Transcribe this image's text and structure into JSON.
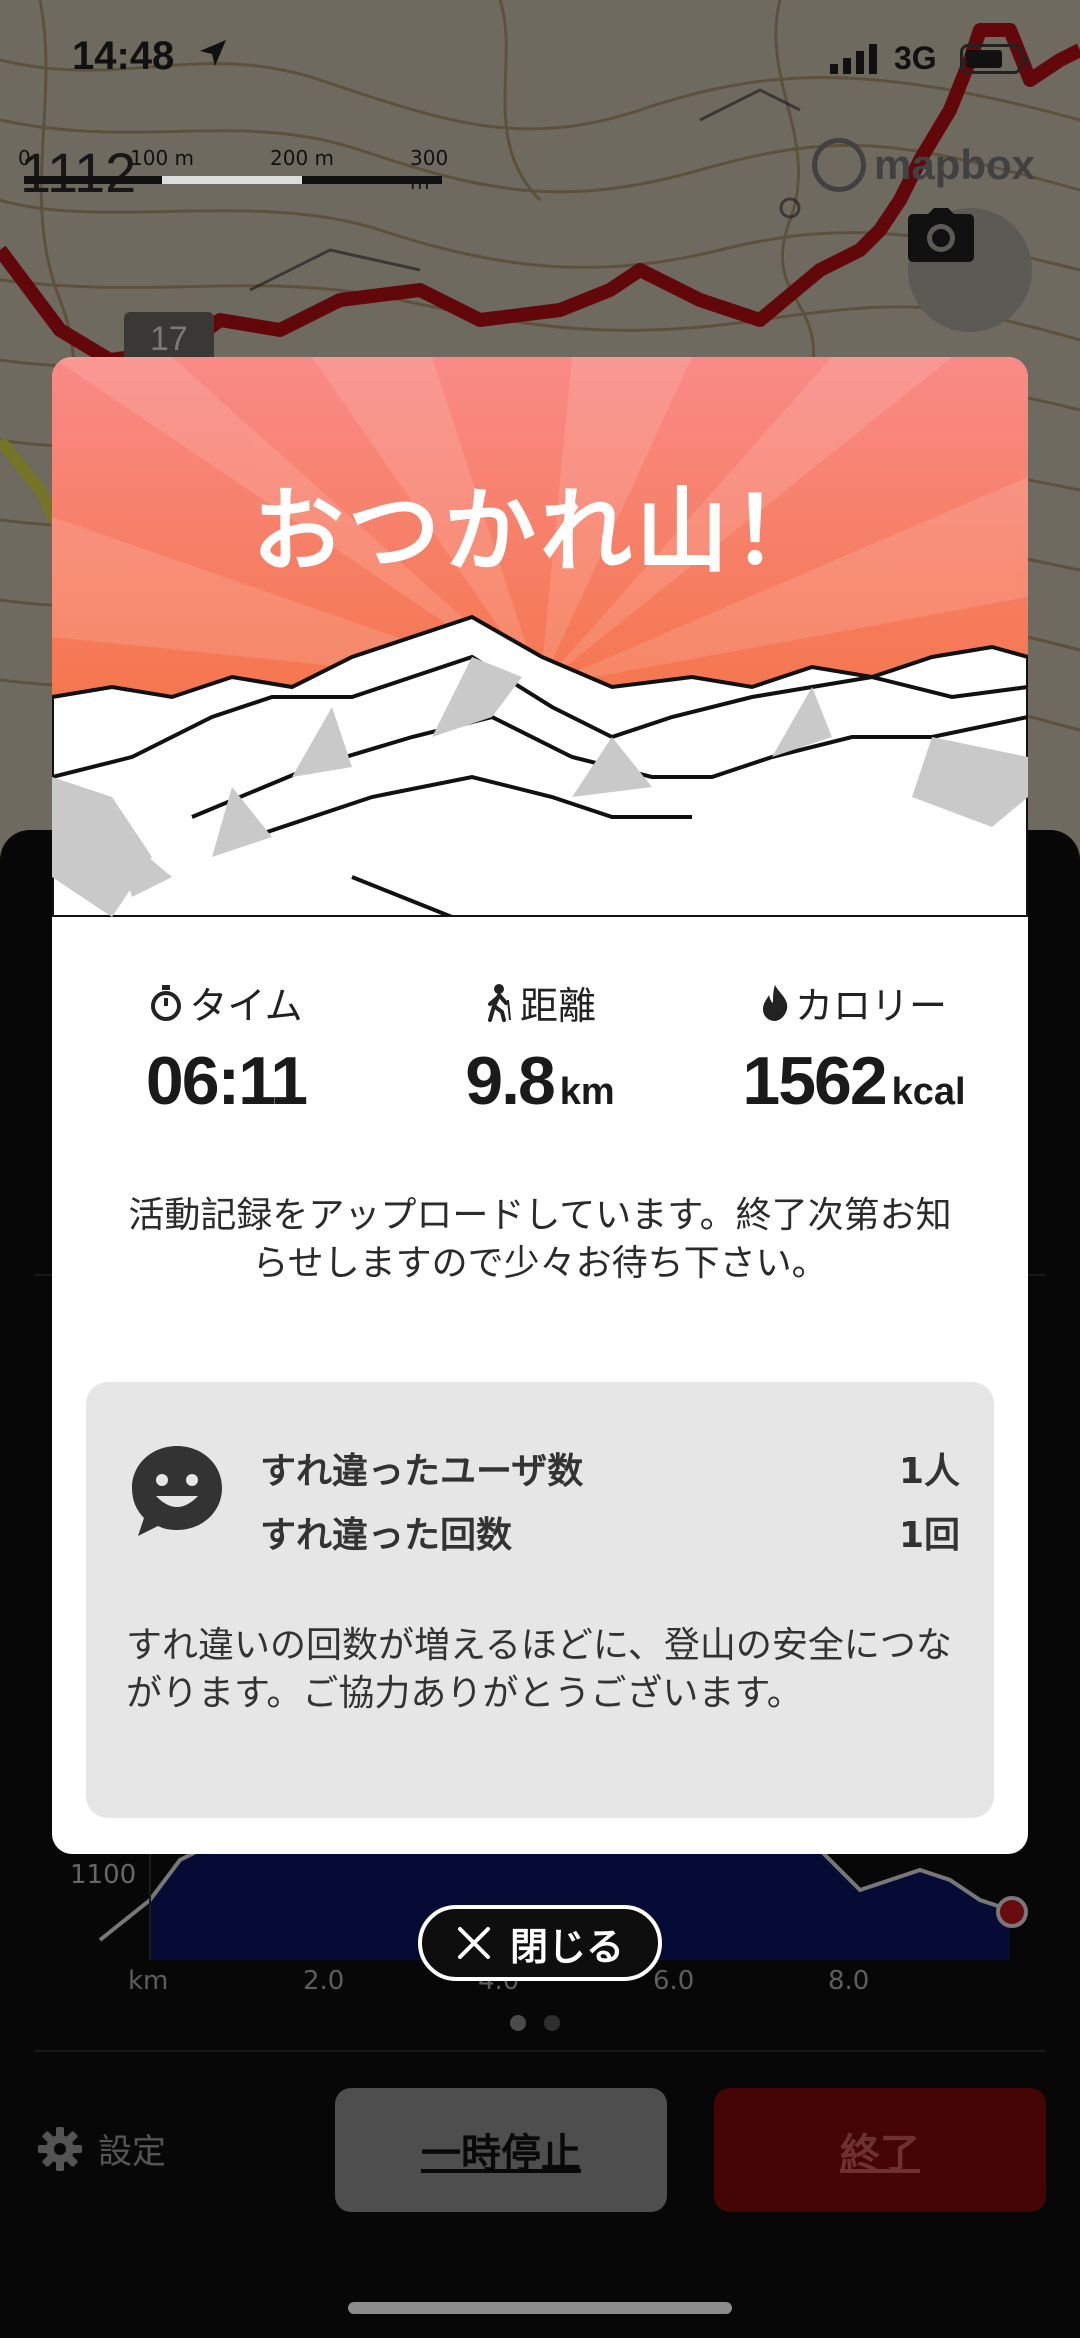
{
  "status_bar": {
    "time": "14:48",
    "network": "3G",
    "icons": [
      "location-arrow-icon",
      "signal-icon",
      "battery-icon"
    ]
  },
  "map": {
    "scale_labels": [
      "0",
      "100 m",
      "200 m",
      "300 m"
    ],
    "map_number": "1112",
    "grid_number": "17",
    "attribution": "mapbox",
    "camera_icon": "camera-icon",
    "route_color": "#b30f14"
  },
  "modal": {
    "title": "おつかれ山！",
    "stats": {
      "time": {
        "label": "タイム",
        "value": "06:11",
        "icon": "stopwatch-icon"
      },
      "distance": {
        "label": "距離",
        "value": "9.8",
        "unit": "km",
        "icon": "hiker-icon"
      },
      "calories": {
        "label": "カロリー",
        "value": "1562",
        "unit": "kcal",
        "icon": "flame-icon"
      }
    },
    "upload_message": "活動記録をアップロードしています。終了次第お知らせしますので少々お待ち下さい。",
    "passing": {
      "users_label": "すれ違ったユーザ数",
      "users_value": "1人",
      "count_label": "すれ違った回数",
      "count_value": "1回",
      "note": "すれ違いの回数が増えるほどに、登山の安全につながります。ご協力ありがとうございます。"
    },
    "hero_gradient": [
      "#f98a86",
      "#f26a2a"
    ]
  },
  "close_button": {
    "label": "閉じる"
  },
  "elevation_chart": {
    "y_label": "1100",
    "x_unit": "km",
    "x_ticks": [
      "2.0",
      "4.0",
      "6.0",
      "8.0"
    ],
    "fill_color": "#0a1560",
    "line_color": "#d9d9d9"
  },
  "footer": {
    "settings_label": "設定",
    "pause_label": "一時停止",
    "end_label": "終了",
    "end_color": "#7f0a0a"
  }
}
